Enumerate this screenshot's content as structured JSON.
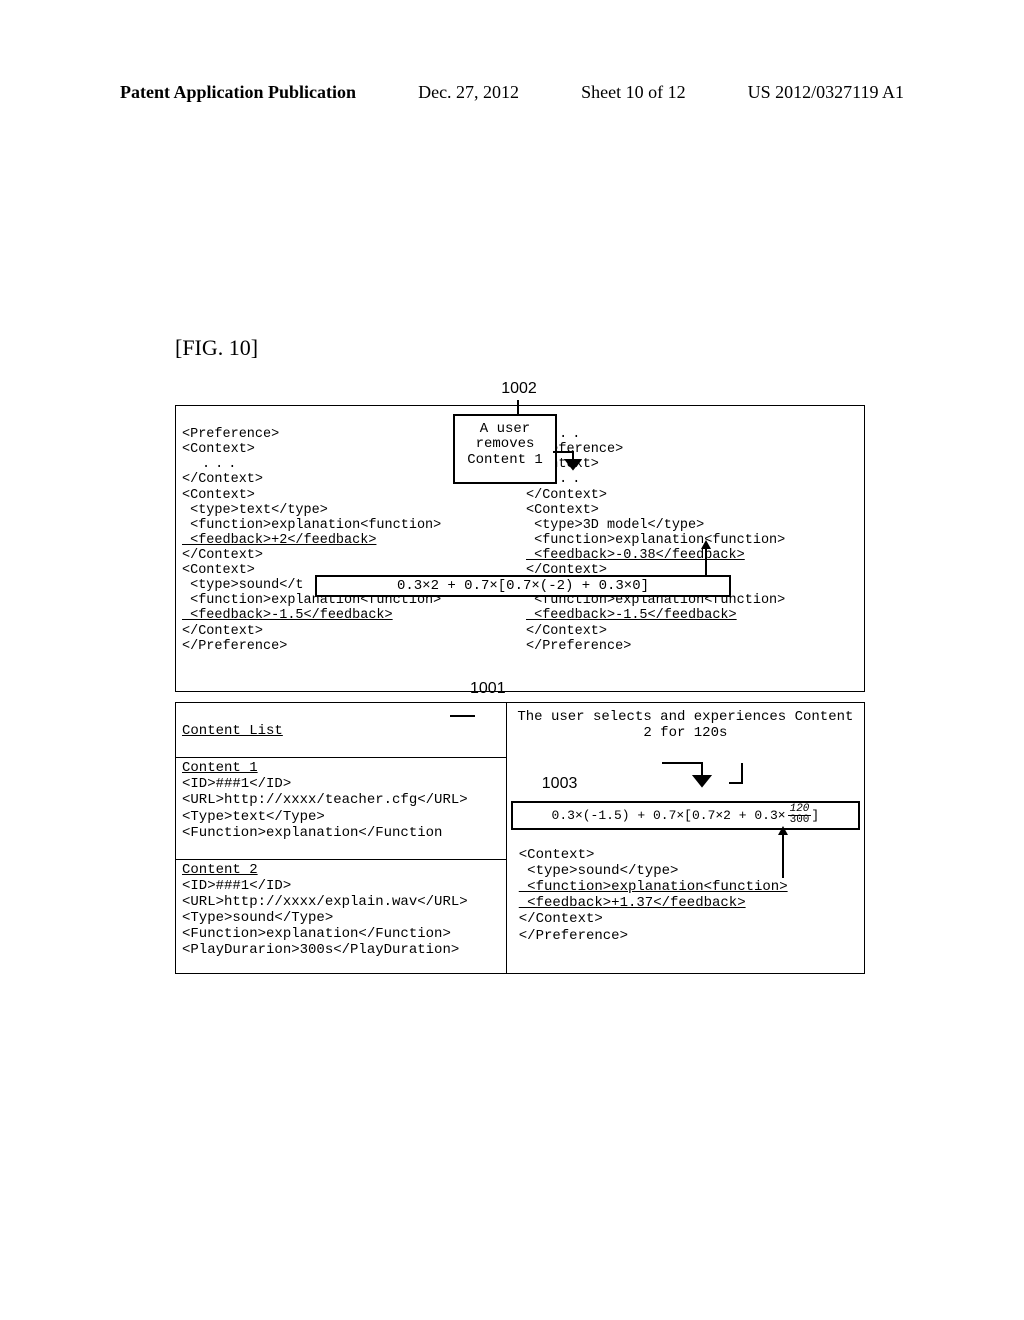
{
  "header": {
    "left": "Patent Application Publication",
    "date": "Dec. 27, 2012",
    "sheet": "Sheet 10 of 12",
    "pubno": "US 2012/0327119 A1"
  },
  "fig_label": "[FIG. 10]",
  "refs": {
    "r1001": "1001",
    "r1002": "1002",
    "r1003": "1003"
  },
  "user_removes": "A user\nremoves\nContent 1",
  "left_pref": {
    "l1": "<Preference>",
    "l2": "<Context>",
    "l3": "...",
    "l4": "</Context>",
    "l5": "<Context>",
    "l6": " <type>text</type>",
    "l7": " <function>explanation<function>",
    "l8": " <feedback>+2</feedback>",
    "l9": "</Context>",
    "l10": "<Context>",
    "l11": " <type>sound</t",
    "l11b": "</type>",
    "l12": " <function>explanation<function>",
    "l13": " <feedback>-1.5</feedback>",
    "l14": "</Context>",
    "l15": "</Preference>"
  },
  "right_pref": {
    "l0": "...",
    "l1": "<Preference>",
    "l2": "<Context>",
    "l3": "...",
    "l4": "</Context>",
    "l5": "<Context>",
    "l6": " <type>3D model</type>",
    "l7": " <function>explanation<function>",
    "l8": " <feedback>-0.38</feedback>",
    "l9": "</Context>",
    "l12": " <function>explanation<function>",
    "l13": " <feedback>-1.5</feedback>",
    "l14": "</Context>",
    "l15": "</Preference>"
  },
  "formula1": "0.3×2 + 0.7×[0.7×(-2) + 0.3×0]",
  "content_list": {
    "title": "Content List",
    "c1_name": "Content 1",
    "c1_l1": "<ID>###1</ID>",
    "c1_l2": "<URL>http://xxxx/teacher.cfg</URL>",
    "c1_l3": "<Type>text</Type>",
    "c1_l4": "<Function>explanation</Function",
    "c2_name": "Content 2",
    "c2_l1": "<ID>###1</ID>",
    "c2_l2": "<URL>http://xxxx/explain.wav</URL>",
    "c2_l3": "<Type>sound</Type>",
    "c2_l4": "<Function>explanation</Function>",
    "c2_l5": "<PlayDurarion>300s</PlayDuration>"
  },
  "user_selects": "The user selects and\nexperiences Content 2 for 120s",
  "formula2_pre": "0.3×(-1.5) + 0.7×[0.7×2 + 0.3×",
  "formula2_num": "120",
  "formula2_den": "300",
  "formula2_post": "]",
  "snippet": {
    "l1": "<Context>",
    "l2": " <type>sound</type>",
    "l3": " <function>explanation<function>",
    "l4": " <feedback>+1.37</feedback>",
    "l5": "</Context>",
    "l6": "</Preference>"
  }
}
